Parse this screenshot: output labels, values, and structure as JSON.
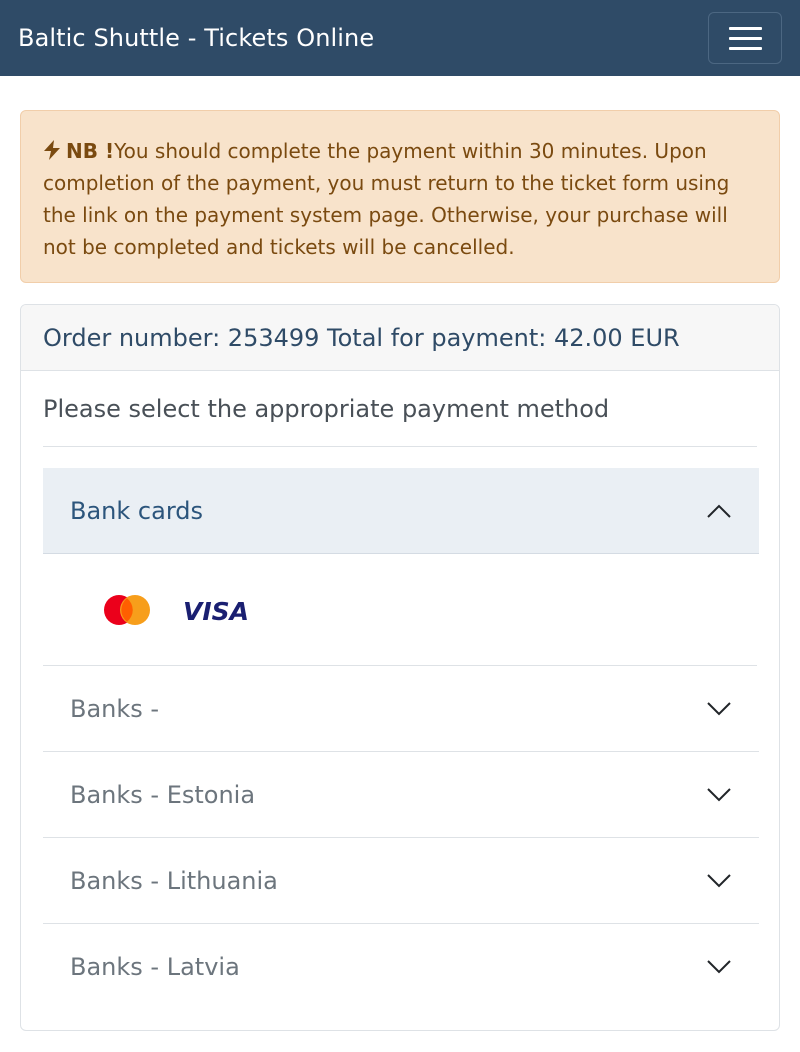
{
  "navbar": {
    "brand": "Baltic Shuttle - Tickets Online",
    "menu_icon": "hamburger-menu-icon",
    "bg_color": "#2f4b67"
  },
  "alert": {
    "icon": "bolt-icon",
    "label": "NB !",
    "text": "You should complete the payment within 30 minutes. Upon completion of the payment, you must return to the ticket form using the link on the payment system page. Otherwise, your purchase will not be completed and tickets will be cancelled."
  },
  "order": {
    "header": "Order number: 253499 Total for payment: 42.00 EUR"
  },
  "payment": {
    "prompt": "Please select the appropriate payment method",
    "methods": [
      {
        "label": "Bank cards",
        "expanded": true,
        "chevron": "chevron-up-icon",
        "providers": [
          "mastercard-logo",
          "visa-logo"
        ]
      },
      {
        "label": "Banks -",
        "expanded": false,
        "chevron": "chevron-down-icon"
      },
      {
        "label": "Banks - Estonia",
        "expanded": false,
        "chevron": "chevron-down-icon"
      },
      {
        "label": "Banks - Lithuania",
        "expanded": false,
        "chevron": "chevron-down-icon"
      },
      {
        "label": "Banks - Latvia",
        "expanded": false,
        "chevron": "chevron-down-icon"
      }
    ],
    "visa_text": "VISA"
  }
}
